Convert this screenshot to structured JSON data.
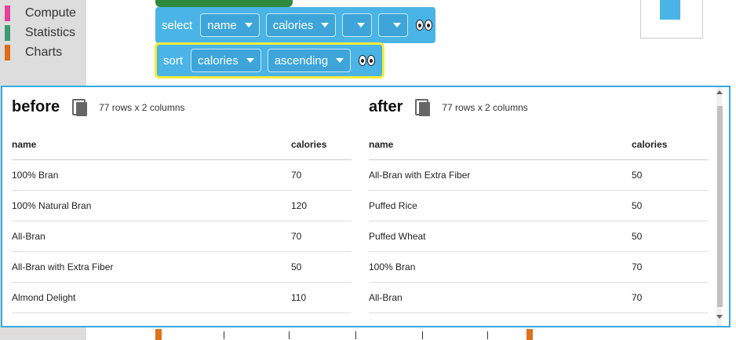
{
  "sidebar": {
    "categories": [
      {
        "label": "Compute",
        "color": "#e83f9a"
      },
      {
        "label": "Statistics",
        "color": "#3a9b73"
      },
      {
        "label": "Charts",
        "color": "#e06a17"
      }
    ]
  },
  "blocks": {
    "select": {
      "keyword": "select",
      "options": [
        "name",
        "calories",
        "",
        ""
      ]
    },
    "sort": {
      "keyword": "sort",
      "column": "calories",
      "order": "ascending"
    }
  },
  "before": {
    "title": "before",
    "row_count": "77 rows x 2 columns",
    "columns": [
      "name",
      "calories"
    ],
    "rows": [
      [
        "100% Bran",
        "70"
      ],
      [
        "100% Natural Bran",
        "120"
      ],
      [
        "All-Bran",
        "70"
      ],
      [
        "All-Bran with Extra Fiber",
        "50"
      ],
      [
        "Almond Delight",
        "110"
      ]
    ]
  },
  "after": {
    "title": "after",
    "row_count": "77 rows x 2 columns",
    "columns": [
      "name",
      "calories"
    ],
    "rows": [
      [
        "All-Bran with Extra Fiber",
        "50"
      ],
      [
        "Puffed Rice",
        "50"
      ],
      [
        "Puffed Wheat",
        "50"
      ],
      [
        "100% Bran",
        "70"
      ],
      [
        "All-Bran",
        "70"
      ]
    ]
  },
  "colors": {
    "block": "#4ab4e6",
    "selected_outline": "#f4ec3a",
    "popup_border": "#36a9e1"
  }
}
